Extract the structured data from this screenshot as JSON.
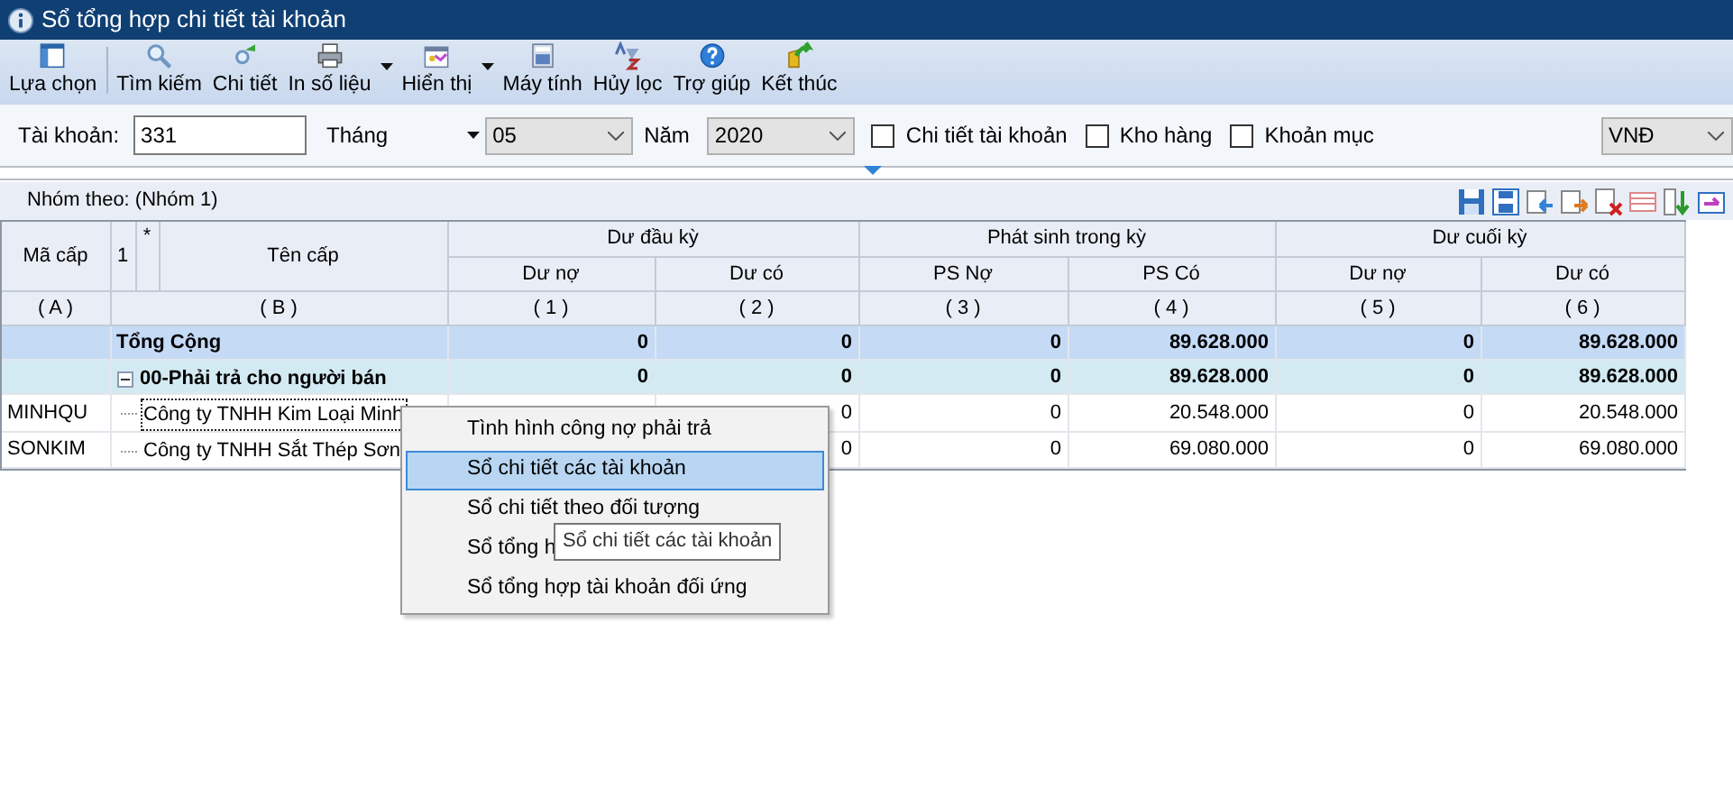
{
  "window": {
    "title": "Sổ tổng hợp chi tiết tài khoản"
  },
  "toolbar": [
    {
      "label": "Lựa chọn",
      "dropdown": false
    },
    {
      "label": "Tìm kiếm",
      "dropdown": false
    },
    {
      "label": "Chi tiết",
      "dropdown": false
    },
    {
      "label": "In số liệu",
      "dropdown": true
    },
    {
      "label": "Hiển thị",
      "dropdown": true
    },
    {
      "label": "Máy tính",
      "dropdown": false
    },
    {
      "label": "Hủy lọc",
      "dropdown": false
    },
    {
      "label": "Trợ giúp",
      "dropdown": false
    },
    {
      "label": "Kết thúc",
      "dropdown": false
    }
  ],
  "filters": {
    "account": {
      "label": "Tài khoản:",
      "value": "331"
    },
    "month": {
      "label": "Tháng",
      "value": "05"
    },
    "year": {
      "label": "Năm",
      "value": "2020"
    },
    "checkboxes": [
      {
        "label": "Chi tiết tài khoản",
        "checked": false
      },
      {
        "label": "Kho hàng",
        "checked": false
      },
      {
        "label": "Khoản mục",
        "checked": false
      }
    ],
    "currency": {
      "value": "VNĐ"
    }
  },
  "group_panel": {
    "label": "Nhóm theo: (Nhóm 1)"
  },
  "table": {
    "header": {
      "code": "Mã cấp",
      "col_1": "1",
      "col_star": "*",
      "name": "Tên cấp",
      "code_index": "( A )",
      "name_index": "( B )",
      "groups": [
        {
          "label": "Dư đầu kỳ",
          "columns": [
            {
              "label": "Dư nợ",
              "index": "( 1 )"
            },
            {
              "label": "Dư có",
              "index": "( 2 )"
            }
          ]
        },
        {
          "label": "Phát sinh trong kỳ",
          "columns": [
            {
              "label": "PS Nợ",
              "index": "( 3 )"
            },
            {
              "label": "PS Có",
              "index": "( 4 )"
            }
          ]
        },
        {
          "label": "Dư cuối kỳ",
          "columns": [
            {
              "label": "Dư nợ",
              "index": "( 5 )"
            },
            {
              "label": "Dư có",
              "index": "( 6 )"
            }
          ]
        }
      ]
    },
    "rows": [
      {
        "kind": "total",
        "name": "Tổng Cộng",
        "values": {
          "col_1": "0",
          "col_2": "0",
          "col_3": "0",
          "col_4": "89.628.000",
          "col_5": "0",
          "col_6": "89.628.000"
        }
      },
      {
        "kind": "group",
        "name": "00-Phải trả cho người bán",
        "expanded": true,
        "values": {
          "col_1": "0",
          "col_2": "0",
          "col_3": "0",
          "col_4": "89.628.000",
          "col_5": "0",
          "col_6": "89.628.000"
        }
      },
      {
        "kind": "detail",
        "code": "MINHQU",
        "name": "Công ty TNHH Kim Loại Minh",
        "focused": true,
        "values": {
          "col_2": "0",
          "col_3": "0",
          "col_4": "20.548.000",
          "col_5": "0",
          "col_6": "20.548.000"
        }
      },
      {
        "kind": "detail",
        "code": "SONKIM",
        "name": "Công ty TNHH Sắt Thép Sơn",
        "focused": false,
        "values": {
          "col_2": "0",
          "col_3": "0",
          "col_4": "69.080.000",
          "col_5": "0",
          "col_6": "69.080.000"
        }
      }
    ]
  },
  "context_menu": {
    "items": [
      {
        "label": "Tình hình công nợ phải trả",
        "selected": false
      },
      {
        "label": "Sổ chi tiết các tài khoản",
        "selected": true
      },
      {
        "label": "Sổ chi tiết theo đối tượng",
        "selected": false
      },
      {
        "label": "Sổ tổng h",
        "selected": false
      },
      {
        "label": "Sổ tổng hợp tài khoản đối ứng",
        "selected": false
      }
    ],
    "tooltip": {
      "text": "Sổ chi tiết các tài khoản"
    }
  }
}
